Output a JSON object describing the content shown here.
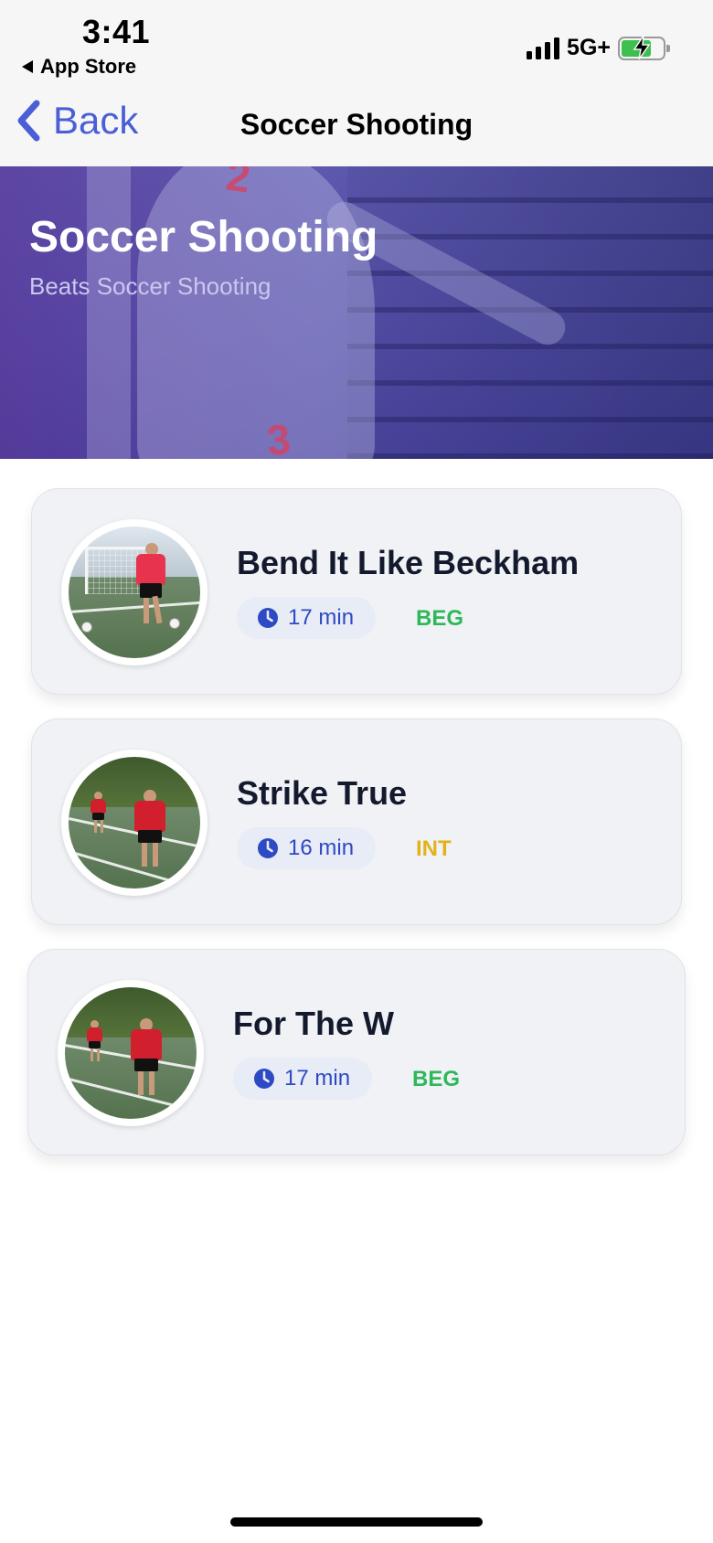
{
  "status_bar": {
    "time": "3:41",
    "back_app_label": "App Store",
    "network": "5G+",
    "battery_level": 0.72
  },
  "nav": {
    "back_label": "Back",
    "title": "Soccer Shooting"
  },
  "hero": {
    "title": "Soccer Shooting",
    "subtitle": "Beats Soccer Shooting"
  },
  "workouts": [
    {
      "title": "Bend It Like Beckham",
      "duration": "17 min",
      "level": "BEG",
      "level_color": "#2db85a"
    },
    {
      "title": "Strike True",
      "duration": "16 min",
      "level": "INT",
      "level_color": "#e3b21a"
    },
    {
      "title": "For The W",
      "duration": "17 min",
      "level": "BEG",
      "level_color": "#2db85a"
    }
  ],
  "colors": {
    "accent": "#4a5fd6",
    "pill_text": "#2e49c4",
    "card_bg": "#f1f2f6"
  },
  "icons": {
    "back": "chevron-left-icon",
    "clock": "clock-icon",
    "signal": "cellular-signal-icon",
    "battery": "battery-charging-icon"
  }
}
